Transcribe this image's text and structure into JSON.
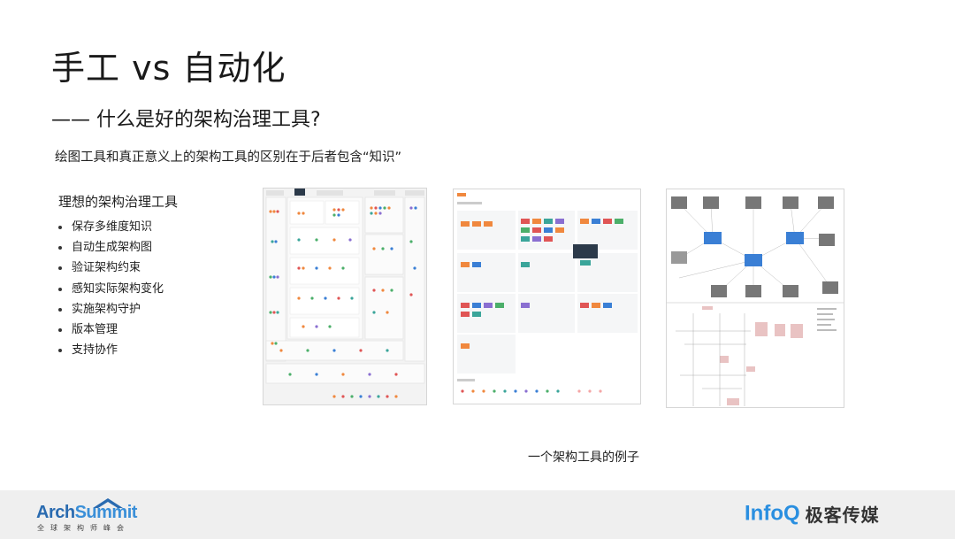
{
  "slide": {
    "title": "手工 vs 自动化",
    "subtitle": "—— 什么是好的架构治理工具?",
    "intro": "绘图工具和真正意义上的架构工具的区别在于后者包含“知识”",
    "list_heading": "理想的架构治理工具",
    "bullets": [
      "保存多维度知识",
      "自动生成架构图",
      "验证架构约束",
      "感知实际架构变化",
      "实施架构守护",
      "版本管理",
      "支持协作"
    ],
    "caption": "一个架构工具的例子"
  },
  "footer": {
    "arch_logo_word_a": "Arch",
    "arch_logo_word_b": "Summit",
    "arch_logo_sub": "全球架构师峰会",
    "infoq_logo_word": "InfoQ",
    "infoq_logo_name": "极客传媒"
  },
  "colors": {
    "accent_blue": "#2a8fe0",
    "node_orange": "#f0883e",
    "node_red": "#e05555",
    "node_green": "#4caf6a",
    "node_purple": "#8a6fd1",
    "node_teal": "#3aa59a",
    "node_blue": "#3a7fd5",
    "footer_bg": "#efefef"
  }
}
